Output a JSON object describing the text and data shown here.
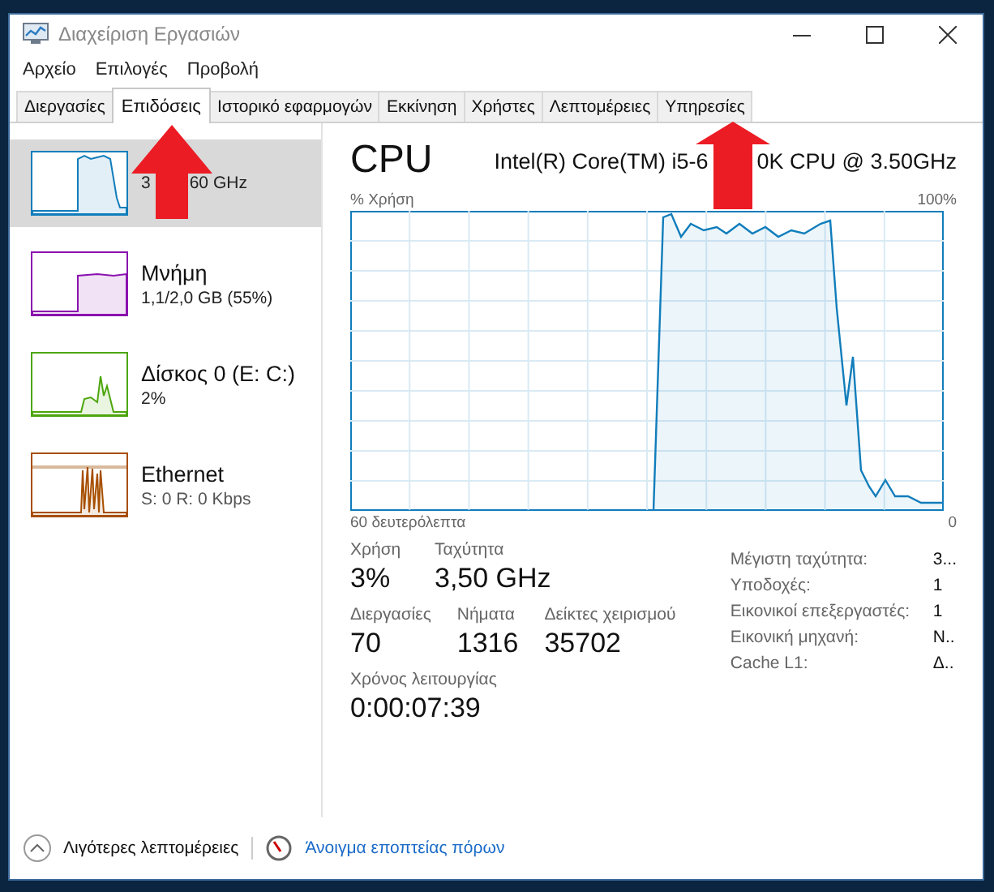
{
  "window": {
    "title": "Διαχείριση Εργασιών"
  },
  "menu": [
    "Αρχείο",
    "Επιλογές",
    "Προβολή"
  ],
  "tabs": [
    {
      "label": "Διεργασίες",
      "selected": false
    },
    {
      "label": "Επιδόσεις",
      "selected": true
    },
    {
      "label": "Ιστορικό εφαρμογών",
      "selected": false
    },
    {
      "label": "Εκκίνηση",
      "selected": false
    },
    {
      "label": "Χρήστες",
      "selected": false
    },
    {
      "label": "Λεπτομέρειες",
      "selected": false
    },
    {
      "label": "Υπηρεσίες",
      "selected": false
    }
  ],
  "sidebar": {
    "items": [
      {
        "kind": "cpu",
        "selected": true,
        "color": "#117dbb",
        "detail": [
          "3",
          "60 GHz"
        ]
      },
      {
        "kind": "memory",
        "selected": false,
        "color": "#8b12ae",
        "title": "Μνήμη",
        "detail": [
          "1,1/2,0 GB (55%)"
        ]
      },
      {
        "kind": "disk",
        "selected": false,
        "color": "#4da60c",
        "title": "Δίσκος 0 (E: C:)",
        "detail": [
          "2%"
        ]
      },
      {
        "kind": "ethernet",
        "selected": false,
        "color": "#a74f01",
        "title": "Ethernet",
        "detail": [
          "S: 0 R: 0 Kbps"
        ]
      }
    ]
  },
  "panel": {
    "title": "CPU",
    "model": [
      "Intel(R) Core(TM) i5-6",
      "0K CPU @ 3.50GHz"
    ],
    "graph": {
      "y_label": "% Χρήση",
      "y_max": "100%",
      "x_label": "60 δευτερόλεπτα",
      "y_min": "0"
    },
    "stats": [
      [
        {
          "label": "Χρήση",
          "value": "3%"
        },
        {
          "label": "Ταχύτητα",
          "value": "3,50 GHz"
        }
      ],
      [
        {
          "label": "Διεργασίες",
          "value": "70"
        },
        {
          "label": "Νήματα",
          "value": "1316"
        },
        {
          "label": "Δείκτες χειρισμού",
          "value": "35702"
        }
      ],
      [
        {
          "label": "Χρόνος λειτουργίας",
          "value": "0:00:07:39"
        }
      ]
    ],
    "details": [
      {
        "label": "Μέγιστη ταχύτητα:",
        "value": "3..."
      },
      {
        "label": "Υποδοχές:",
        "value": "1"
      },
      {
        "label": "Εικονικοί επεξεργαστές:",
        "value": "1"
      },
      {
        "label": "Εικονική μηχανή:",
        "value": "N.."
      },
      {
        "label": "Cache L1:",
        "value": "Δ.."
      }
    ]
  },
  "footer": {
    "less": "Λιγότερες λεπτομέρειες",
    "link": "Άνοιγμα εποπτείας πόρων"
  }
}
